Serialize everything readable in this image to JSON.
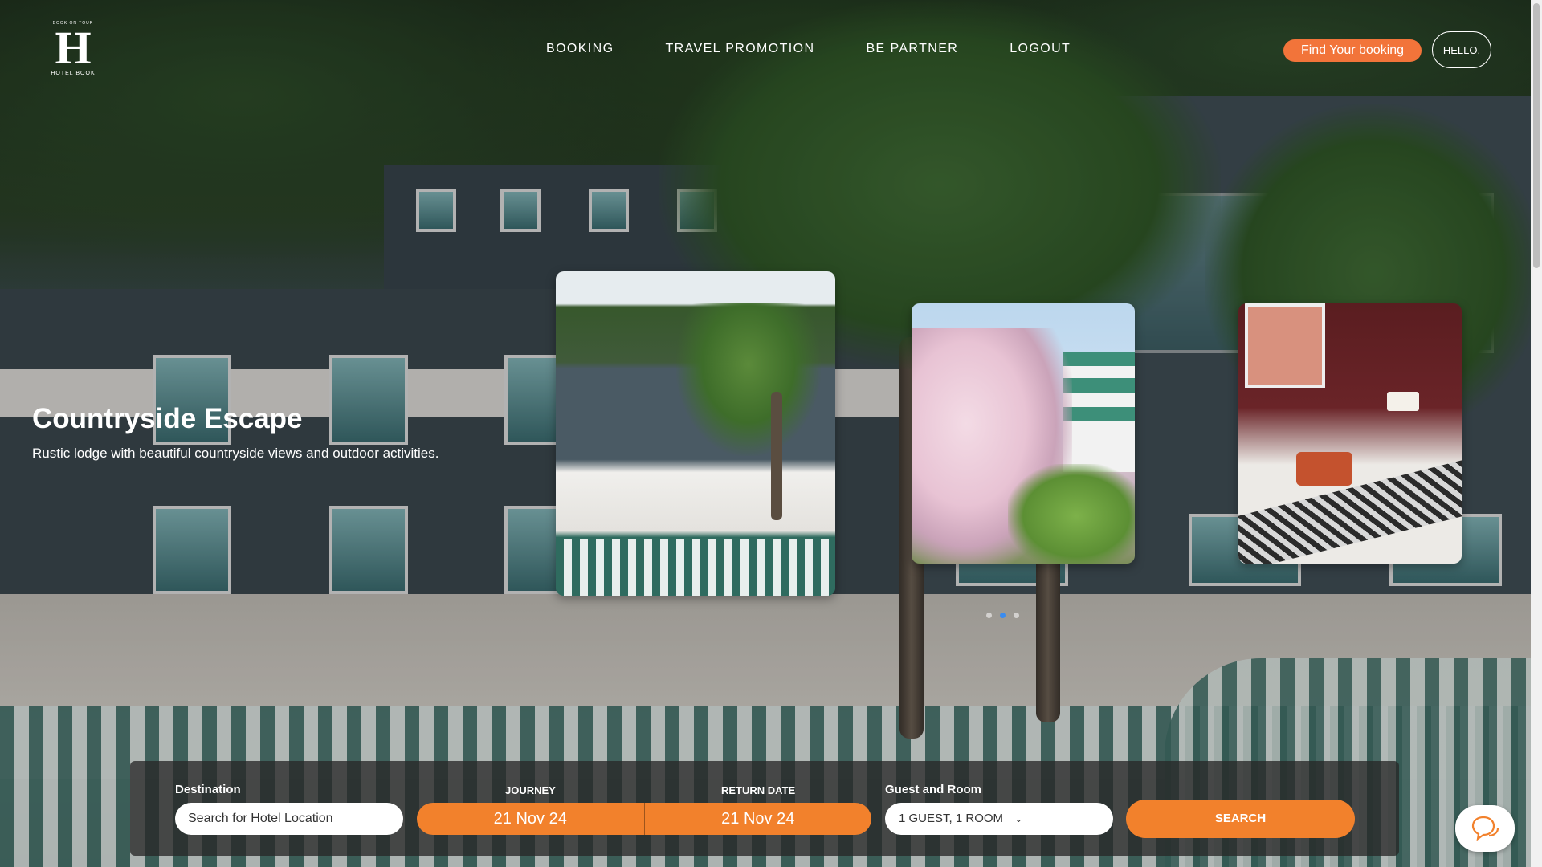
{
  "brand": {
    "tagline": "BOOK ON TOUR",
    "mark": "H",
    "name": "HOTEL BOOK"
  },
  "nav": {
    "items": [
      {
        "label": "BOOKING"
      },
      {
        "label": "TRAVEL PROMOTION"
      },
      {
        "label": "BE PARTNER"
      },
      {
        "label": "LOGOUT"
      }
    ],
    "find_booking_label": "Find Your booking",
    "hello_label": "HELLO,"
  },
  "hero": {
    "title": "Countryside Escape",
    "subtitle": "Rustic lodge with beautiful countryside views and outdoor activities.",
    "slides": [
      {
        "icon": "resort-pool-photo"
      },
      {
        "icon": "cherry-blossom-castle-photo"
      },
      {
        "icon": "hotel-bedroom-photo"
      }
    ],
    "active_dot": 1,
    "dot_count": 3
  },
  "search": {
    "destination_label": "Destination",
    "destination_placeholder": "Search for Hotel Location",
    "journey_label": "JOURNEY",
    "journey_value": "21 Nov 24",
    "return_label": "RETURN DATE",
    "return_value": "21 Nov 24",
    "guest_label": "Guest and Room",
    "guest_value": "1 GUEST, 1 ROOM",
    "search_label": "SEARCH"
  },
  "colors": {
    "accent": "#f2812c",
    "accent_button": "#f2743a",
    "active_dot": "#3a8cf0"
  }
}
